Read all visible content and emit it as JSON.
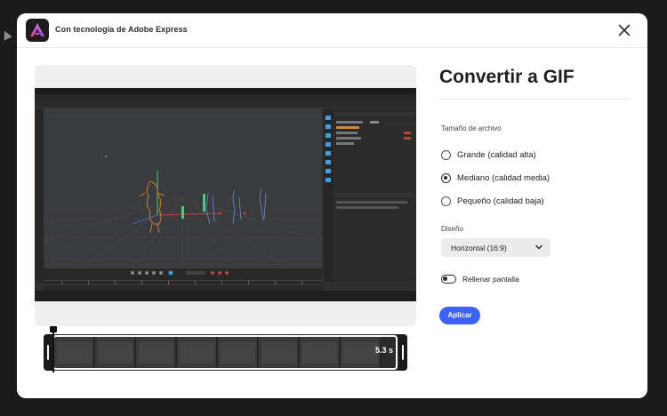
{
  "header": {
    "title": "Con tecnología de Adobe Express",
    "logo_icon": "adobe-express-logo",
    "close_icon": "close-icon"
  },
  "preview": {
    "filmstrip": {
      "duration": "5.3 s"
    }
  },
  "panel": {
    "title": "Convertir a GIF",
    "file_size": {
      "label": "Tamaño de archivo",
      "options": [
        {
          "label": "Grande (calidad alta)",
          "selected": false
        },
        {
          "label": "Mediano (calidad media)",
          "selected": true
        },
        {
          "label": "Pequeño (calidad baja)",
          "selected": false
        }
      ]
    },
    "layout": {
      "label": "Diseño",
      "selected": "Horizontal (16:9)"
    },
    "fill_screen": {
      "label": "Rellenar pantalla",
      "on": false
    },
    "apply_label": "Aplicar"
  },
  "colors": {
    "accent": "#3b63fb",
    "backdrop": "#1b1b1b",
    "modal": "#ffffff"
  }
}
